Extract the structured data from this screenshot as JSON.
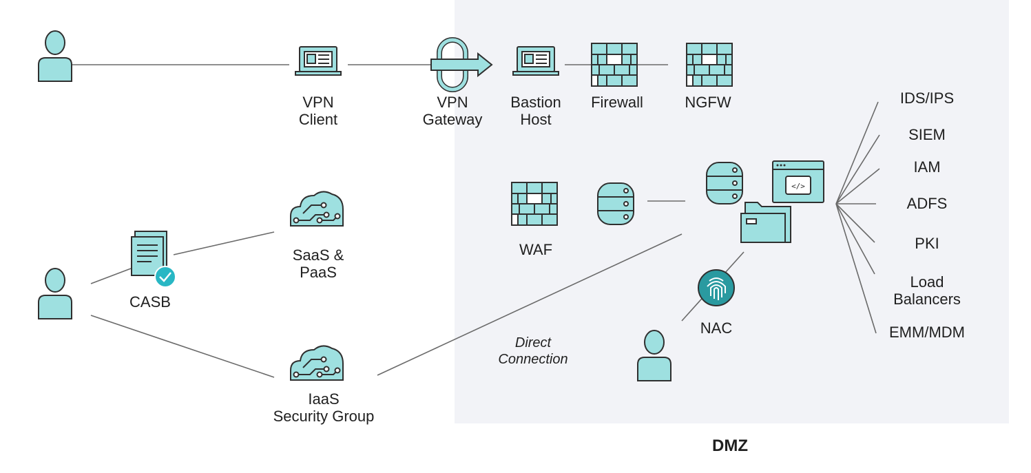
{
  "colors": {
    "icon_fill": "#9ee0e0",
    "icon_stroke": "#2f2f2f",
    "dmz_background": "#f2f3f7",
    "fingerprint_badge": "#2a9aa0",
    "check_badge": "#28b7c4"
  },
  "zone": {
    "label": "DMZ"
  },
  "nodes": {
    "vpn_client": {
      "line1": "VPN",
      "line2": "Client",
      "icon": "laptop-icon"
    },
    "vpn_gateway": {
      "line1": "VPN",
      "line2": "Gateway",
      "icon": "tunnel-arrow-icon"
    },
    "bastion_host": {
      "line1": "Bastion",
      "line2": "Host",
      "icon": "laptop-icon"
    },
    "firewall": {
      "label": "Firewall",
      "icon": "brick-wall-icon"
    },
    "ngfw": {
      "label": "NGFW",
      "icon": "brick-wall-icon"
    },
    "casb": {
      "label": "CASB",
      "icon": "document-check-icon"
    },
    "saas_paas": {
      "line1": "SaaS &",
      "line2": "PaaS",
      "icon": "cloud-circuit-icon"
    },
    "iaas": {
      "line1": "IaaS",
      "line2": "Security Group",
      "icon": "cloud-circuit-icon"
    },
    "waf": {
      "label": "WAF",
      "icon": "brick-wall-icon"
    },
    "nac": {
      "label": "NAC",
      "icon": "fingerprint-icon"
    },
    "direct_connection": {
      "line1": "Direct",
      "line2": "Connection"
    }
  },
  "services": [
    "IDS/IPS",
    "SIEM",
    "IAM",
    "ADFS",
    "PKI",
    "Load",
    "Balancers",
    "EMM/MDM"
  ]
}
